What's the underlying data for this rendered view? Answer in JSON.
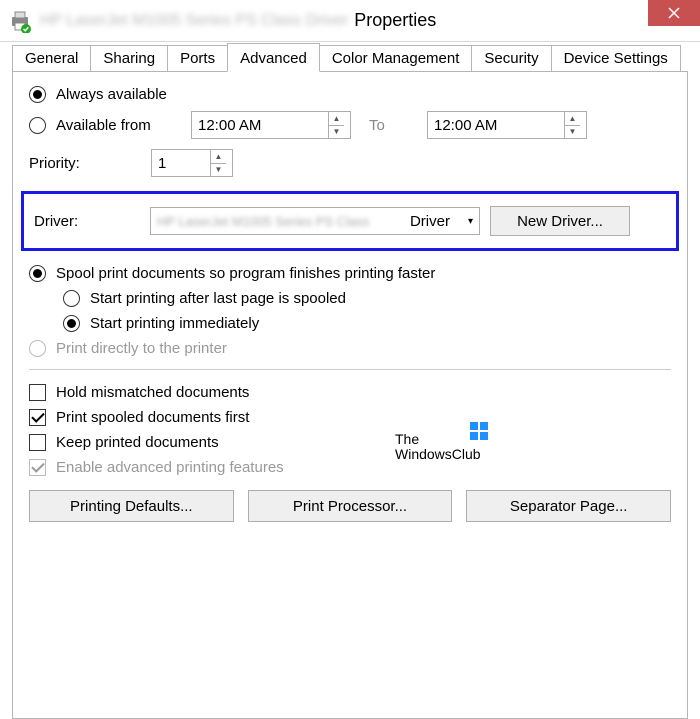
{
  "titlebar": {
    "title_suffix": "Properties"
  },
  "tabs": {
    "general": "General",
    "sharing": "Sharing",
    "ports": "Ports",
    "advanced": "Advanced",
    "color_mgmt": "Color Management",
    "security": "Security",
    "device_settings": "Device Settings"
  },
  "availability": {
    "always": "Always available",
    "from": "Available from",
    "time_from": "12:00 AM",
    "to_label": "To",
    "time_to": "12:00 AM"
  },
  "priority": {
    "label": "Priority:",
    "value": "1"
  },
  "driver": {
    "label": "Driver:",
    "combo_suffix": "Driver",
    "new_btn": "New Driver..."
  },
  "spool": {
    "spool_docs": "Spool print documents so program finishes printing faster",
    "after_last": "Start printing after last page is spooled",
    "immediately": "Start printing immediately",
    "direct": "Print directly to the printer"
  },
  "options": {
    "hold_mismatched": "Hold mismatched documents",
    "print_spooled_first": "Print spooled documents first",
    "keep_printed": "Keep printed documents",
    "enable_advanced": "Enable advanced printing features"
  },
  "buttons": {
    "printing_defaults": "Printing Defaults...",
    "print_processor": "Print Processor...",
    "separator_page": "Separator Page..."
  },
  "watermark": {
    "line1": "The",
    "line2": "WindowsClub"
  }
}
